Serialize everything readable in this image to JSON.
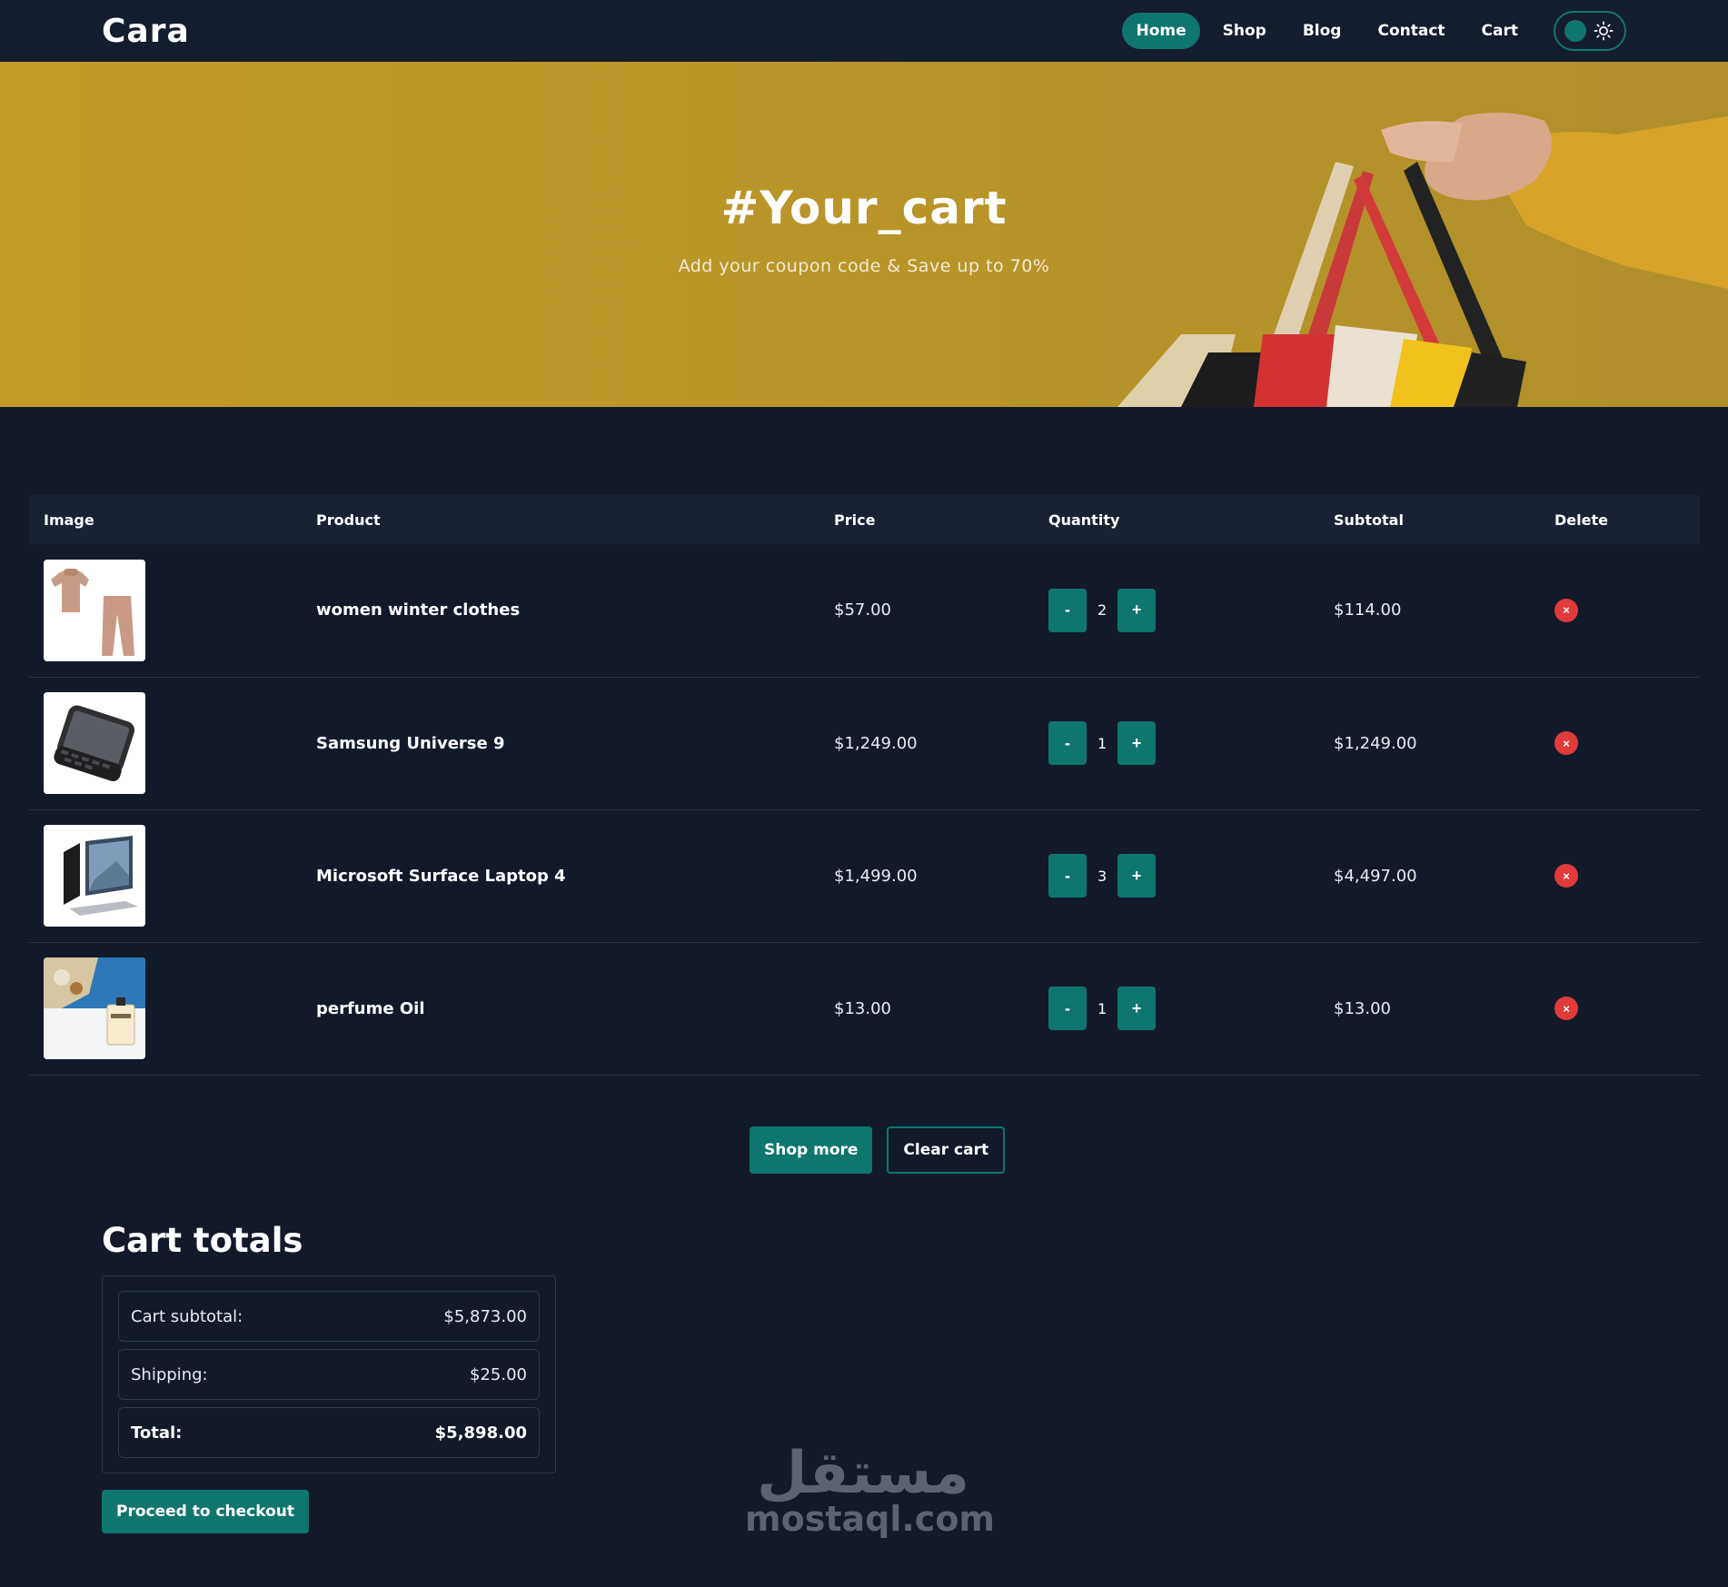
{
  "brand": {
    "logo": "Cara"
  },
  "nav": {
    "items": [
      {
        "label": "Home",
        "active": true
      },
      {
        "label": "Shop",
        "active": false
      },
      {
        "label": "Blog",
        "active": false
      },
      {
        "label": "Contact",
        "active": false
      },
      {
        "label": "Cart",
        "active": false
      }
    ],
    "theme_toggle_icon": "sun-icon"
  },
  "hero": {
    "title": "#Your_cart",
    "subtitle": "Add your coupon code & Save up to 70%"
  },
  "table": {
    "headers": [
      "Image",
      "Product",
      "Price",
      "Quantity",
      "Subtotal",
      "Delete"
    ],
    "rows": [
      {
        "image": "clothes-thumbnail",
        "product": "women winter clothes",
        "price": "$57.00",
        "quantity": "2",
        "subtotal": "$114.00"
      },
      {
        "image": "phone-thumbnail",
        "product": "Samsung Universe 9",
        "price": "$1,249.00",
        "quantity": "1",
        "subtotal": "$1,249.00"
      },
      {
        "image": "laptop-thumbnail",
        "product": "Microsoft Surface Laptop 4",
        "price": "$1,499.00",
        "quantity": "3",
        "subtotal": "$4,497.00"
      },
      {
        "image": "perfume-thumbnail",
        "product": "perfume Oil",
        "price": "$13.00",
        "quantity": "1",
        "subtotal": "$13.00"
      }
    ],
    "decrement_label": "-",
    "increment_label": "+",
    "delete_label": "×"
  },
  "actions": {
    "shop_more": "Shop more",
    "clear_cart": "Clear cart"
  },
  "totals": {
    "title": "Cart totals",
    "rows": [
      {
        "label": "Cart subtotal:",
        "value": "$5,873.00"
      },
      {
        "label": "Shipping:",
        "value": "$25.00"
      },
      {
        "label": "Total:",
        "value": "$5,898.00"
      }
    ],
    "checkout": "Proceed to checkout"
  },
  "watermark": {
    "arabic": "مستقل",
    "latin": "mostaql.com"
  },
  "colors": {
    "accent": "#0f766e",
    "background": "#121a2a",
    "hero": "#b8952b",
    "danger": "#e03a3a"
  }
}
